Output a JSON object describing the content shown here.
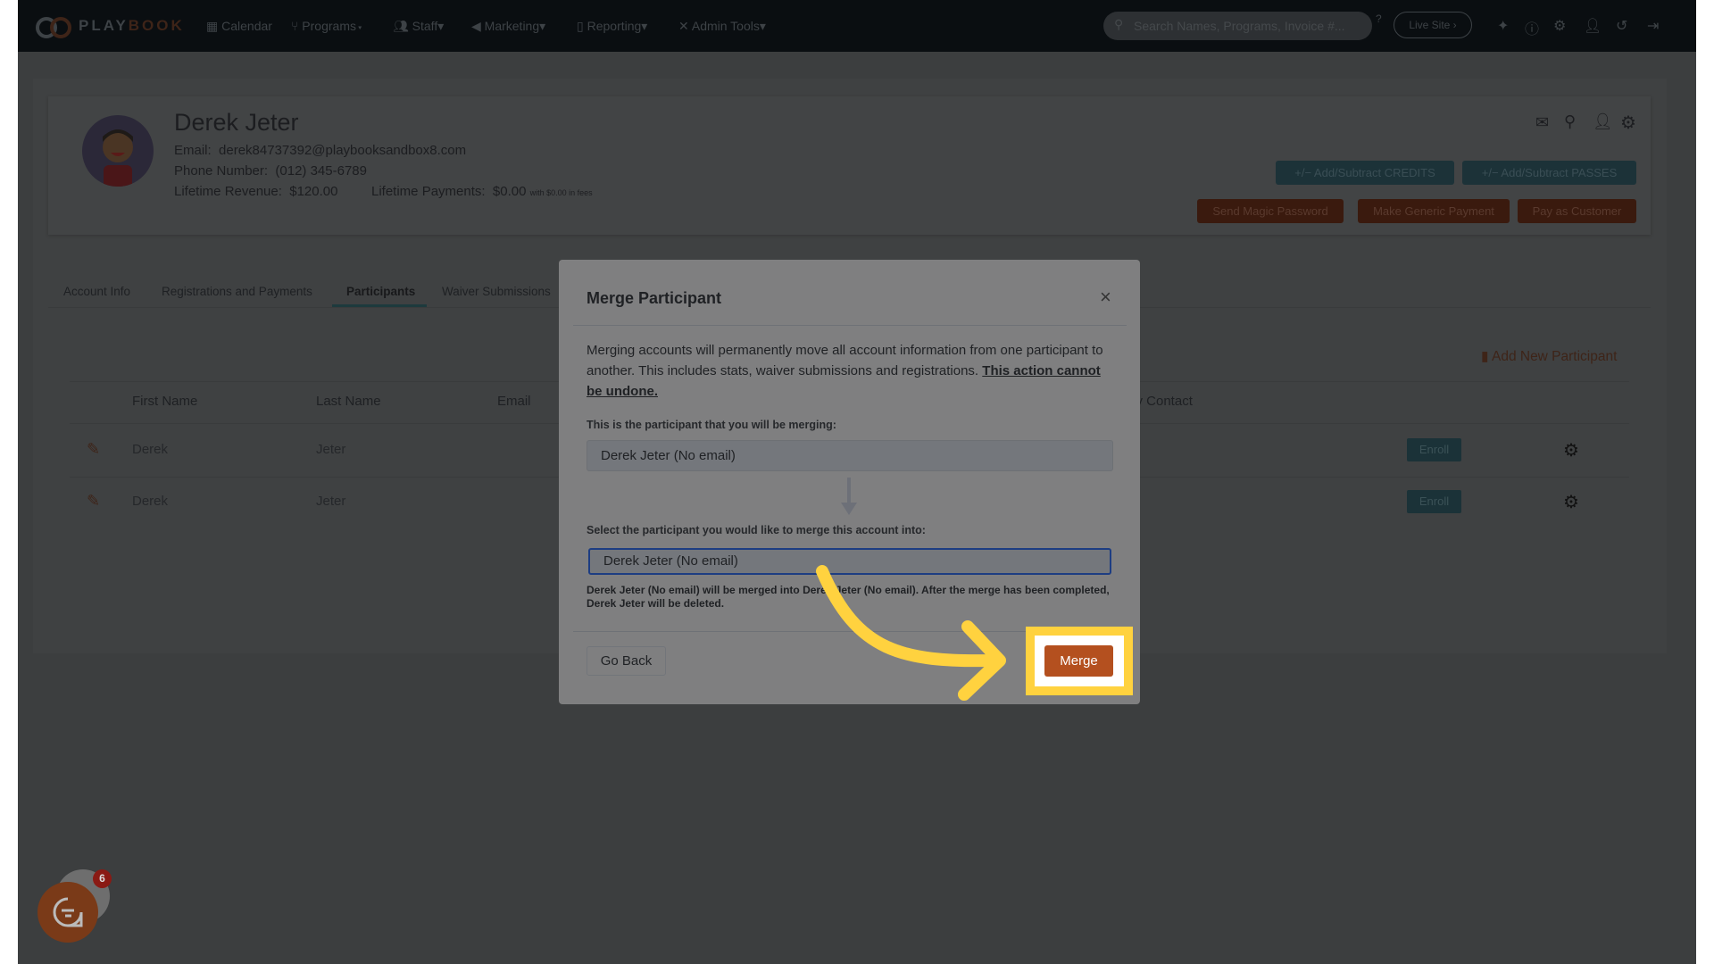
{
  "nav": {
    "logo_text_1": "PLAY",
    "logo_text_2": "BOOK",
    "items": [
      {
        "label": "Calendar",
        "icon": "calendar-icon"
      },
      {
        "label": "Programs",
        "icon": "programs-icon"
      },
      {
        "label": "Staff",
        "icon": "users-icon"
      },
      {
        "label": "Marketing",
        "icon": "megaphone-icon"
      },
      {
        "label": "Reporting",
        "icon": "file-icon"
      },
      {
        "label": "Admin Tools",
        "icon": "tools-icon"
      }
    ],
    "search_placeholder": "Search Names, Programs, Invoice #...",
    "live_site": "Live Site ›",
    "right_icons": [
      "bullhorn-plus-icon",
      "help-icon",
      "gear-icon",
      "add-user-icon",
      "history-icon",
      "logout-icon"
    ]
  },
  "profile": {
    "name": "Derek Jeter",
    "email_label": "Email:",
    "email": "derek84737392@playbooksandbox8.com",
    "phone_label": "Phone Number:",
    "phone": "(012) 345-6789",
    "revenue_label": "Lifetime Revenue:",
    "revenue": "$120.00",
    "payments_label": "Lifetime Payments:",
    "payments": "$0.00",
    "fees_note": "with $0.00 in fees",
    "buttons": {
      "credits": "+/−  Add/Subtract CREDITS",
      "passes": "+/−  Add/Subtract PASSES",
      "magic_password": "Send Magic Password",
      "generic_payment": "Make Generic Payment",
      "pay_as_customer": "Pay as Customer"
    }
  },
  "tabs": [
    {
      "label": "Account Info"
    },
    {
      "label": "Registrations and Payments"
    },
    {
      "label": "Participants",
      "active": true
    },
    {
      "label": "Waiver Submissions"
    }
  ],
  "participants": {
    "add_new": "Add New Participant",
    "columns": [
      "First Name",
      "Last Name",
      "Email",
      "cy Contact"
    ],
    "rows": [
      {
        "first": "Derek",
        "last": "Jeter",
        "enroll": "Enroll"
      },
      {
        "first": "Derek",
        "last": "Jeter",
        "enroll": "Enroll"
      }
    ]
  },
  "modal": {
    "title": "Merge Participant",
    "close": "×",
    "description": "Merging accounts will permanently move all account information from one participant to another. This includes stats, waiver submissions and registrations.",
    "warning": "This action cannot be undone.",
    "source_label": "This is the participant that you will be merging:",
    "source_value": "Derek Jeter (No email)",
    "target_label": "Select the participant you would like to merge this account into:",
    "target_value": "Derek Jeter (No email)",
    "summary": "Derek Jeter (No email) will be merged into Derek Jeter (No email). After the merge has been completed, Derek Jeter will be deleted.",
    "go_back": "Go Back",
    "merge": "Merge"
  },
  "chat": {
    "badge": "6"
  },
  "colors": {
    "accent": "#b4501f",
    "highlight": "#ffd23f",
    "teal": "#1c3238"
  }
}
